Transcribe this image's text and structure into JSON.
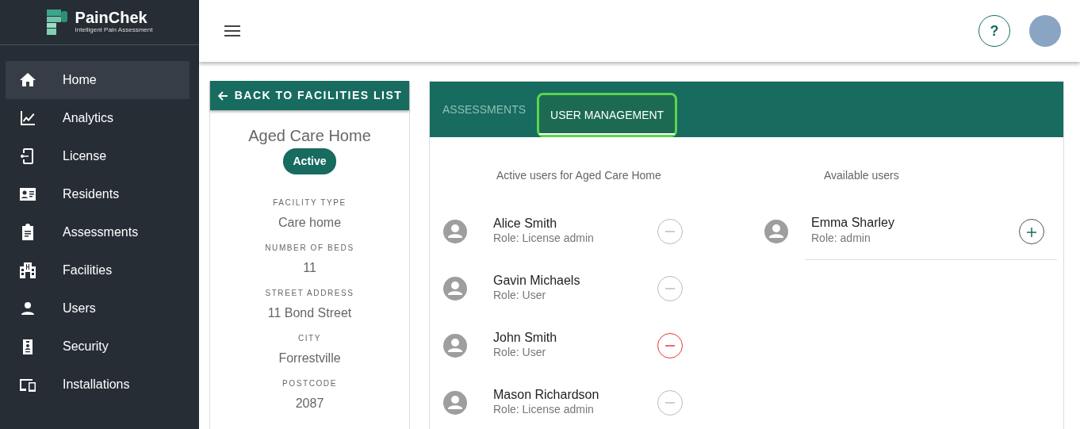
{
  "logo": {
    "name": "PainChek",
    "tagline": "Intelligent Pain Assessment"
  },
  "sidebar": {
    "items": [
      {
        "label": "Home",
        "selected": true
      },
      {
        "label": "Analytics",
        "selected": false
      },
      {
        "label": "License",
        "selected": false
      },
      {
        "label": "Residents",
        "selected": false
      },
      {
        "label": "Assessments",
        "selected": false
      },
      {
        "label": "Facilities",
        "selected": false
      },
      {
        "label": "Users",
        "selected": false
      },
      {
        "label": "Security",
        "selected": false
      },
      {
        "label": "Installations",
        "selected": false
      }
    ]
  },
  "topbar": {
    "help": "?"
  },
  "back_button": "BACK TO FACILITIES LIST",
  "facility": {
    "name": "Aged Care Home",
    "status": "Active",
    "fields": [
      {
        "label": "FACILITY TYPE",
        "value": "Care home"
      },
      {
        "label": "NUMBER OF BEDS",
        "value": "11"
      },
      {
        "label": "STREET ADDRESS",
        "value": "11 Bond Street"
      },
      {
        "label": "CITY",
        "value": "Forrestville"
      },
      {
        "label": "POSTCODE",
        "value": "2087"
      }
    ]
  },
  "tabs": [
    {
      "label": "ASSESSMENTS",
      "selected": false,
      "focused": false
    },
    {
      "label": "USER MANAGEMENT",
      "selected": true,
      "focused": true
    }
  ],
  "active_users": {
    "title": "Active users for Aged Care Home",
    "users": [
      {
        "name": "Alice Smith",
        "role": "Role: License admin",
        "hovered": false
      },
      {
        "name": "Gavin Michaels",
        "role": "Role: User",
        "hovered": false
      },
      {
        "name": "John Smith",
        "role": "Role: User",
        "hovered": true
      },
      {
        "name": "Mason Richardson",
        "role": "Role: License admin",
        "hovered": false
      }
    ]
  },
  "available_users": {
    "title": "Available users",
    "users": [
      {
        "name": "Emma Sharley",
        "role": "Role: admin"
      }
    ]
  }
}
